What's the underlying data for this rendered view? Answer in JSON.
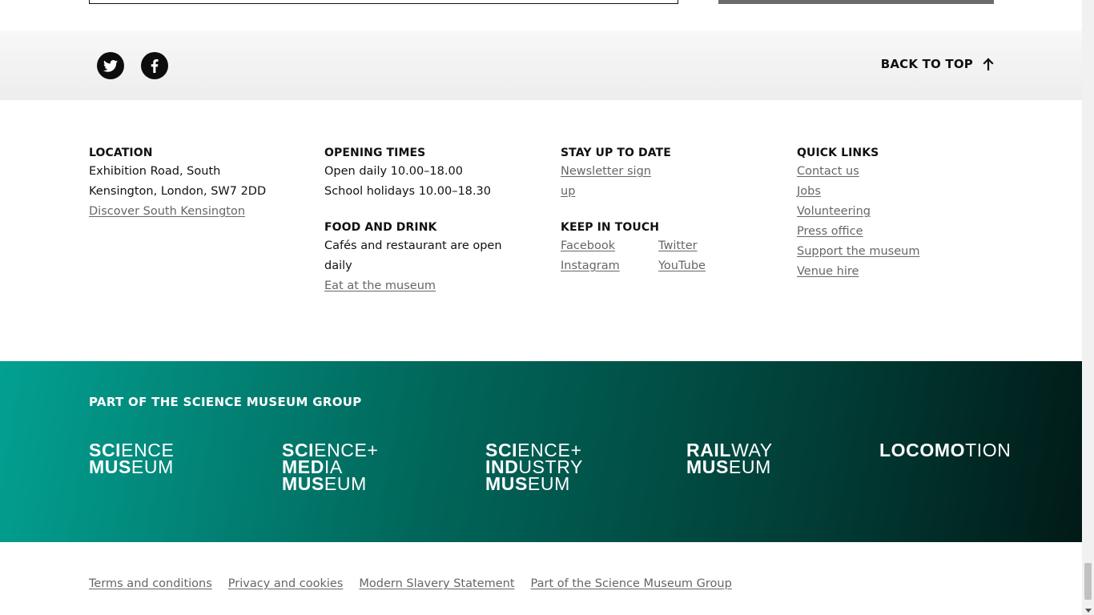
{
  "social": {
    "twitter_icon": "twitter-icon",
    "facebook_icon": "facebook-icon",
    "back_to_top": "BACK TO TOP"
  },
  "location": {
    "heading": "LOCATION",
    "line1": "Exhibition Road, South",
    "line2": "Kensington, London, SW7 2DD",
    "link": "Discover South Kensington"
  },
  "opening": {
    "heading": "OPENING TIMES",
    "line1": "Open daily 10.00–18.00",
    "line2": "School holidays 10.00–18.30"
  },
  "food": {
    "heading": "FOOD AND DRINK",
    "line1": "Cafés and restaurant are open",
    "line2": "daily",
    "link": "Eat at the museum"
  },
  "stay": {
    "heading": "STAY UP TO DATE",
    "link_line1": "Newsletter sign",
    "link_line2": "up"
  },
  "keep": {
    "heading": "KEEP IN TOUCH",
    "facebook": "Facebook",
    "twitter": "Twitter",
    "instagram": "Instagram",
    "youtube": "YouTube"
  },
  "quick": {
    "heading": "QUICK LINKS",
    "items": [
      "Contact us",
      "Jobs",
      "Volunteering",
      "Press office",
      "Support the museum",
      "Venue hire"
    ]
  },
  "group": {
    "title": "PART OF THE SCIENCE MUSEUM GROUP",
    "logos": {
      "science_museum": {
        "a1": "SCI",
        "a2": "ENCE",
        "b1": "MUS",
        "b2": "EUM"
      },
      "media_museum": {
        "a1": "SCI",
        "a2": "ENCE+",
        "b1": "MED",
        "b2": "IA",
        "c1": "MUS",
        "c2": "EUM"
      },
      "industry_museum": {
        "a1": "SCI",
        "a2": "ENCE+",
        "b1": "IND",
        "b2": "USTRY",
        "c1": "MUS",
        "c2": "EUM"
      },
      "railway_museum": {
        "a1": "RAIL",
        "a2": "WAY",
        "b1": "MUS",
        "b2": "EUM"
      },
      "locomotion": {
        "a1": "LOCOMO",
        "a2": "TION"
      }
    }
  },
  "legal": {
    "terms": "Terms and conditions",
    "privacy": "Privacy and cookies",
    "slavery": "Modern Slavery Statement",
    "group": "Part of the Science Museum Group"
  }
}
